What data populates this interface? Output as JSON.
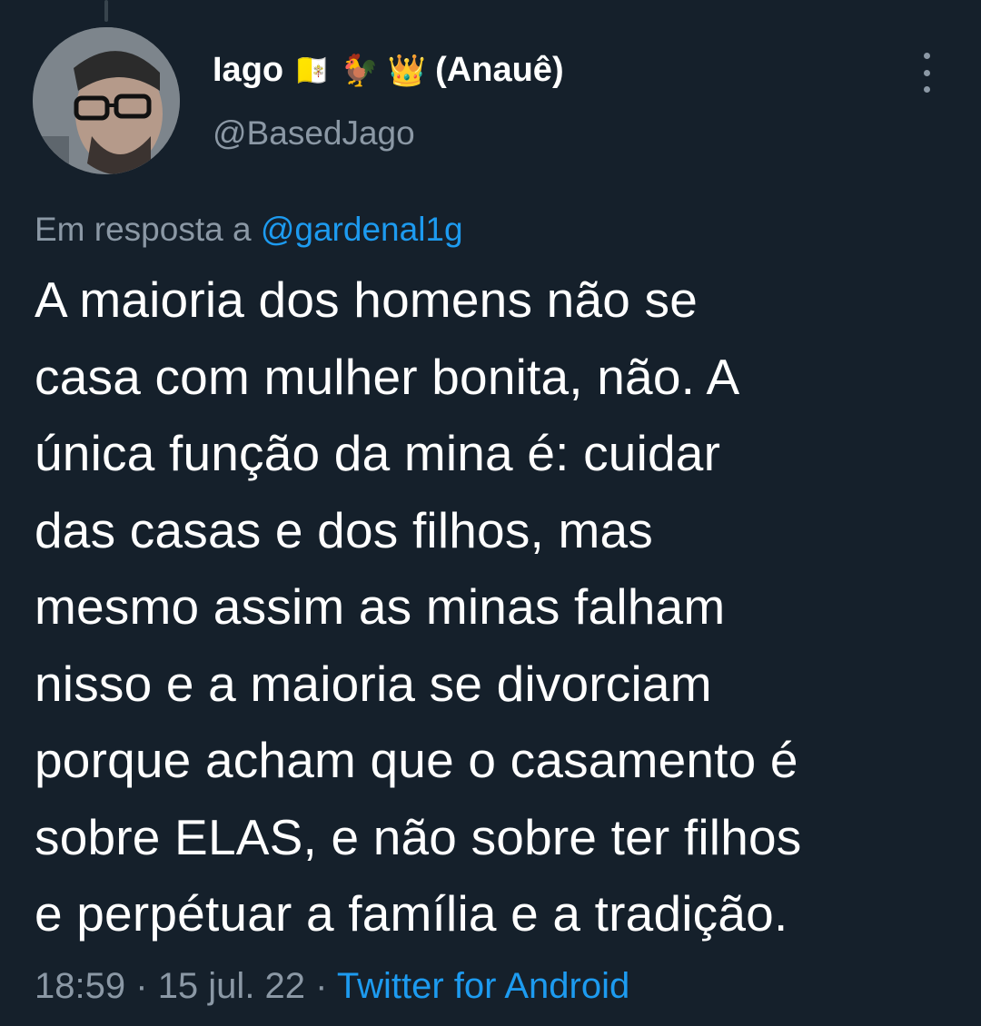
{
  "tweet": {
    "author": {
      "display_name": "Iago",
      "name_suffix": "(Anauê)",
      "handle": "@BasedJago",
      "name_emojis": [
        {
          "name": "vatican-flag-icon",
          "glyph": "🇻🇦"
        },
        {
          "name": "rooster-icon",
          "glyph": "🐓"
        },
        {
          "name": "crown-icon",
          "glyph": "👑"
        }
      ]
    },
    "reply_context": {
      "prefix": "Em resposta a",
      "mention": "@gardenal1g"
    },
    "text_lines": [
      "A maioria dos homens não se",
      "casa com mulher bonita, não. A",
      "única função da mina é: cuidar",
      "das casas e dos filhos, mas",
      "mesmo assim as minas falham",
      "nisso e a maioria se divorciam",
      "porque acham que o casamento é",
      "sobre ELAS, e não sobre ter filhos",
      "e perpétuar a família e a tradição."
    ],
    "meta": {
      "time": "18:59",
      "separator": "·",
      "date": "15 jul. 22",
      "source": "Twitter for Android"
    }
  },
  "colors": {
    "background": "#15202b",
    "primary_text": "#ffffff",
    "secondary_text": "#8b98a5",
    "accent": "#1d9bf0"
  },
  "icons": {
    "more": "more-options-icon"
  }
}
